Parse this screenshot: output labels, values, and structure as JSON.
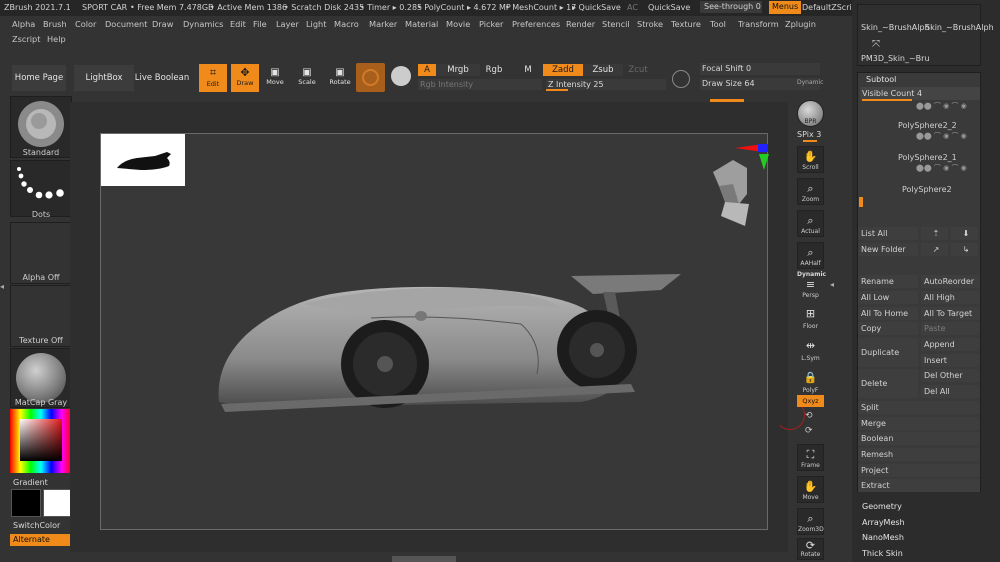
{
  "titlebar": {
    "app": "ZBrush 2021.7.1",
    "doc": "SPORT CAR",
    "free_mem": "• Free Mem 7.478GB",
    "active_mem": "• Active Mem 1386",
    "scratch": "• Scratch Disk 2435",
    "timer": "• Timer ▸ 0.285",
    "poly": "• PolyCount ▸ 4.672 MP",
    "mesh": "• MeshCount ▸ 17",
    "quicksave": "▸ QuickSave",
    "ac": "AC",
    "quicksave2": "QuickSave",
    "seethrough": "See-through 0",
    "menus": "Menus",
    "script": "DefaultZScript"
  },
  "menubar": [
    "Alpha",
    "Brush",
    "Color",
    "Document",
    "Draw",
    "Dynamics",
    "Edit",
    "File",
    "Layer",
    "Light",
    "Macro",
    "Marker",
    "Material",
    "Movie",
    "Picker",
    "Preferences",
    "Render",
    "Stencil",
    "Stroke",
    "Texture",
    "Tool",
    "Transform",
    "Zplugin"
  ],
  "menubar2": [
    "Zscript",
    "Help"
  ],
  "toolbar": {
    "home": "Home Page",
    "lightbox": "LightBox",
    "liveboolean": "Live Boolean",
    "edit": "Edit",
    "draw": "Draw",
    "move": "Move",
    "scale": "Scale",
    "rotate": "Rotate",
    "a": "A",
    "mrgb": "Mrgb",
    "rgb": "Rgb",
    "m": "M",
    "zadd": "Zadd",
    "zsub": "Zsub",
    "zcut": "Zcut",
    "rgb_intensity": "Rgb Intensity",
    "z_intensity": "Z Intensity 25",
    "focal": "Focal Shift 0",
    "drawsize": "Draw Size 64",
    "dynamic": "Dynamic"
  },
  "leftshelf": {
    "standard": "Standard",
    "dots": "Dots",
    "alpha": "Alpha Off",
    "texture": "Texture Off",
    "matcap": "MatCap Gray",
    "gradient": "Gradient",
    "switchcolor": "SwitchColor",
    "alternate": "Alternate"
  },
  "rightshelf": {
    "bpr": "BPR",
    "spix": "SPix 3",
    "scroll": "Scroll",
    "zoom": "Zoom",
    "actual": "Actual",
    "aahalf": "AAHalf",
    "dynamic": "Dynamic",
    "persp": "Persp",
    "floor": "Floor",
    "lsym": "L.Sym",
    "polyf": "PolyF",
    "xyz": "Qxyz",
    "frame": "Frame",
    "move": "Move",
    "zoom3d": "Zoom3D",
    "rotate": "Rotate"
  },
  "tray": {
    "brush1": "Skin_~BrushAlph",
    "brush2": "Skin_~BrushAlph",
    "brush3": "PM3D_Skin_~Bru",
    "subtool": "Subtool",
    "visible": "Visible Count 4",
    "items": [
      "PolySphere2_2",
      "PolySphere2_1",
      "PolySphere2"
    ],
    "listall": "List All",
    "newfolder": "New Folder",
    "rename": "Rename",
    "autoreorder": "AutoReorder",
    "alllow": "All Low",
    "allhigh": "All High",
    "alltohome": "All To Home",
    "alltotarget": "All To Target",
    "copy": "Copy",
    "paste": "Paste",
    "duplicate": "Duplicate",
    "append": "Append",
    "insert": "Insert",
    "delete": "Delete",
    "delother": "Del Other",
    "delall": "Del All",
    "split": "Split",
    "merge": "Merge",
    "boolean": "Boolean",
    "remesh": "Remesh",
    "project": "Project",
    "extract": "Extract",
    "geometry": "Geometry",
    "arraymesh": "ArrayMesh",
    "nanomesh": "NanoMesh",
    "thickskin": "Thick Skin"
  },
  "colors": {
    "accent": "#f08a1a",
    "bg": "#333333"
  }
}
